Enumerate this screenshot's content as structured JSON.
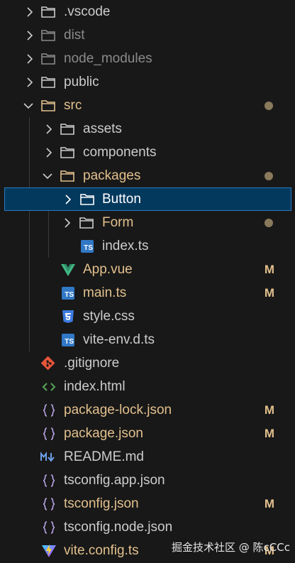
{
  "explorer": {
    "items": [
      {
        "label": ".vscode",
        "icon": "folder-icon",
        "chevron": "chevron-right-icon"
      },
      {
        "label": "dist",
        "icon": "folder-icon",
        "chevron": "chevron-right-icon",
        "dimmed": true
      },
      {
        "label": "node_modules",
        "icon": "folder-icon",
        "chevron": "chevron-right-icon",
        "dimmed": true
      },
      {
        "label": "public",
        "icon": "folder-icon",
        "chevron": "chevron-right-icon"
      },
      {
        "label": "src",
        "icon": "folder-icon",
        "chevron": "chevron-down-icon",
        "status": "dot"
      },
      {
        "label": "assets",
        "icon": "folder-icon",
        "chevron": "chevron-right-icon"
      },
      {
        "label": "components",
        "icon": "folder-icon",
        "chevron": "chevron-right-icon"
      },
      {
        "label": "packages",
        "icon": "folder-icon",
        "chevron": "chevron-down-icon",
        "status": "dot"
      },
      {
        "label": "Button",
        "icon": "folder-icon",
        "chevron": "chevron-right-icon",
        "selected": true
      },
      {
        "label": "Form",
        "icon": "folder-icon",
        "chevron": "chevron-right-icon",
        "status": "dot"
      },
      {
        "label": "index.ts",
        "icon": "typescript-file-icon",
        "ts_text": "TS"
      },
      {
        "label": "App.vue",
        "icon": "vue-file-icon",
        "status": "M"
      },
      {
        "label": "main.ts",
        "icon": "typescript-file-icon",
        "ts_text": "TS",
        "status": "M"
      },
      {
        "label": "style.css",
        "icon": "css-file-icon"
      },
      {
        "label": "vite-env.d.ts",
        "icon": "typescript-file-icon",
        "ts_text": "TS"
      },
      {
        "label": ".gitignore",
        "icon": "git-icon"
      },
      {
        "label": "index.html",
        "icon": "html-file-icon"
      },
      {
        "label": "package-lock.json",
        "icon": "json-file-icon",
        "status": "M"
      },
      {
        "label": "package.json",
        "icon": "json-file-icon",
        "status": "M"
      },
      {
        "label": "README.md",
        "icon": "markdown-file-icon"
      },
      {
        "label": "tsconfig.app.json",
        "icon": "json-file-icon"
      },
      {
        "label": "tsconfig.json",
        "icon": "json-file-icon",
        "status": "M"
      },
      {
        "label": "tsconfig.node.json",
        "icon": "json-file-icon"
      },
      {
        "label": "vite.config.ts",
        "icon": "vite-file-icon",
        "status": "M"
      }
    ]
  },
  "colors": {
    "background": "#181818",
    "text": "#cccccc",
    "dimmed": "#8a8a8a",
    "modified": "#e2c08d",
    "selection": "#04395e",
    "selection_border": "#2b79c2"
  },
  "watermark": "掘金技术社区 @ 陈cCCc"
}
